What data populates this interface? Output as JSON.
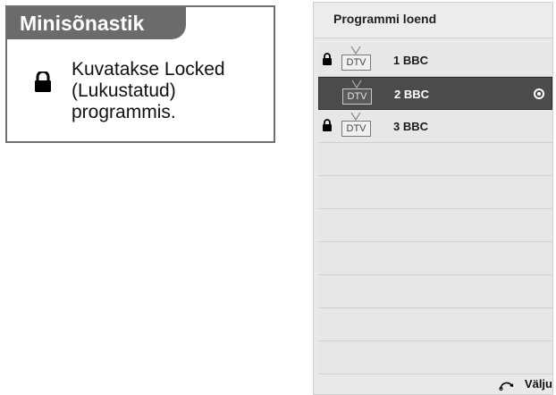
{
  "glossary": {
    "title": "Minisõnastik",
    "description": "Kuvatakse Locked\n(Lukustatud)\nprogrammis.",
    "icon": "lock-icon"
  },
  "program_list": {
    "title": "Programmi loend",
    "channels": [
      {
        "type": "DTV",
        "name": "1 BBC",
        "locked": true,
        "selected": false
      },
      {
        "type": "DTV",
        "name": "2 BBC",
        "locked": false,
        "selected": true
      },
      {
        "type": "DTV",
        "name": "3 BBC",
        "locked": true,
        "selected": false
      }
    ],
    "empty_rows": 7,
    "footer": {
      "exit_label": "Välju",
      "exit_icon": "back-arrow-icon"
    }
  },
  "colors": {
    "title_bg": "#6b6b6b",
    "panel_bg": "#e9e9e9",
    "selected_row": "#4b4b4b"
  }
}
